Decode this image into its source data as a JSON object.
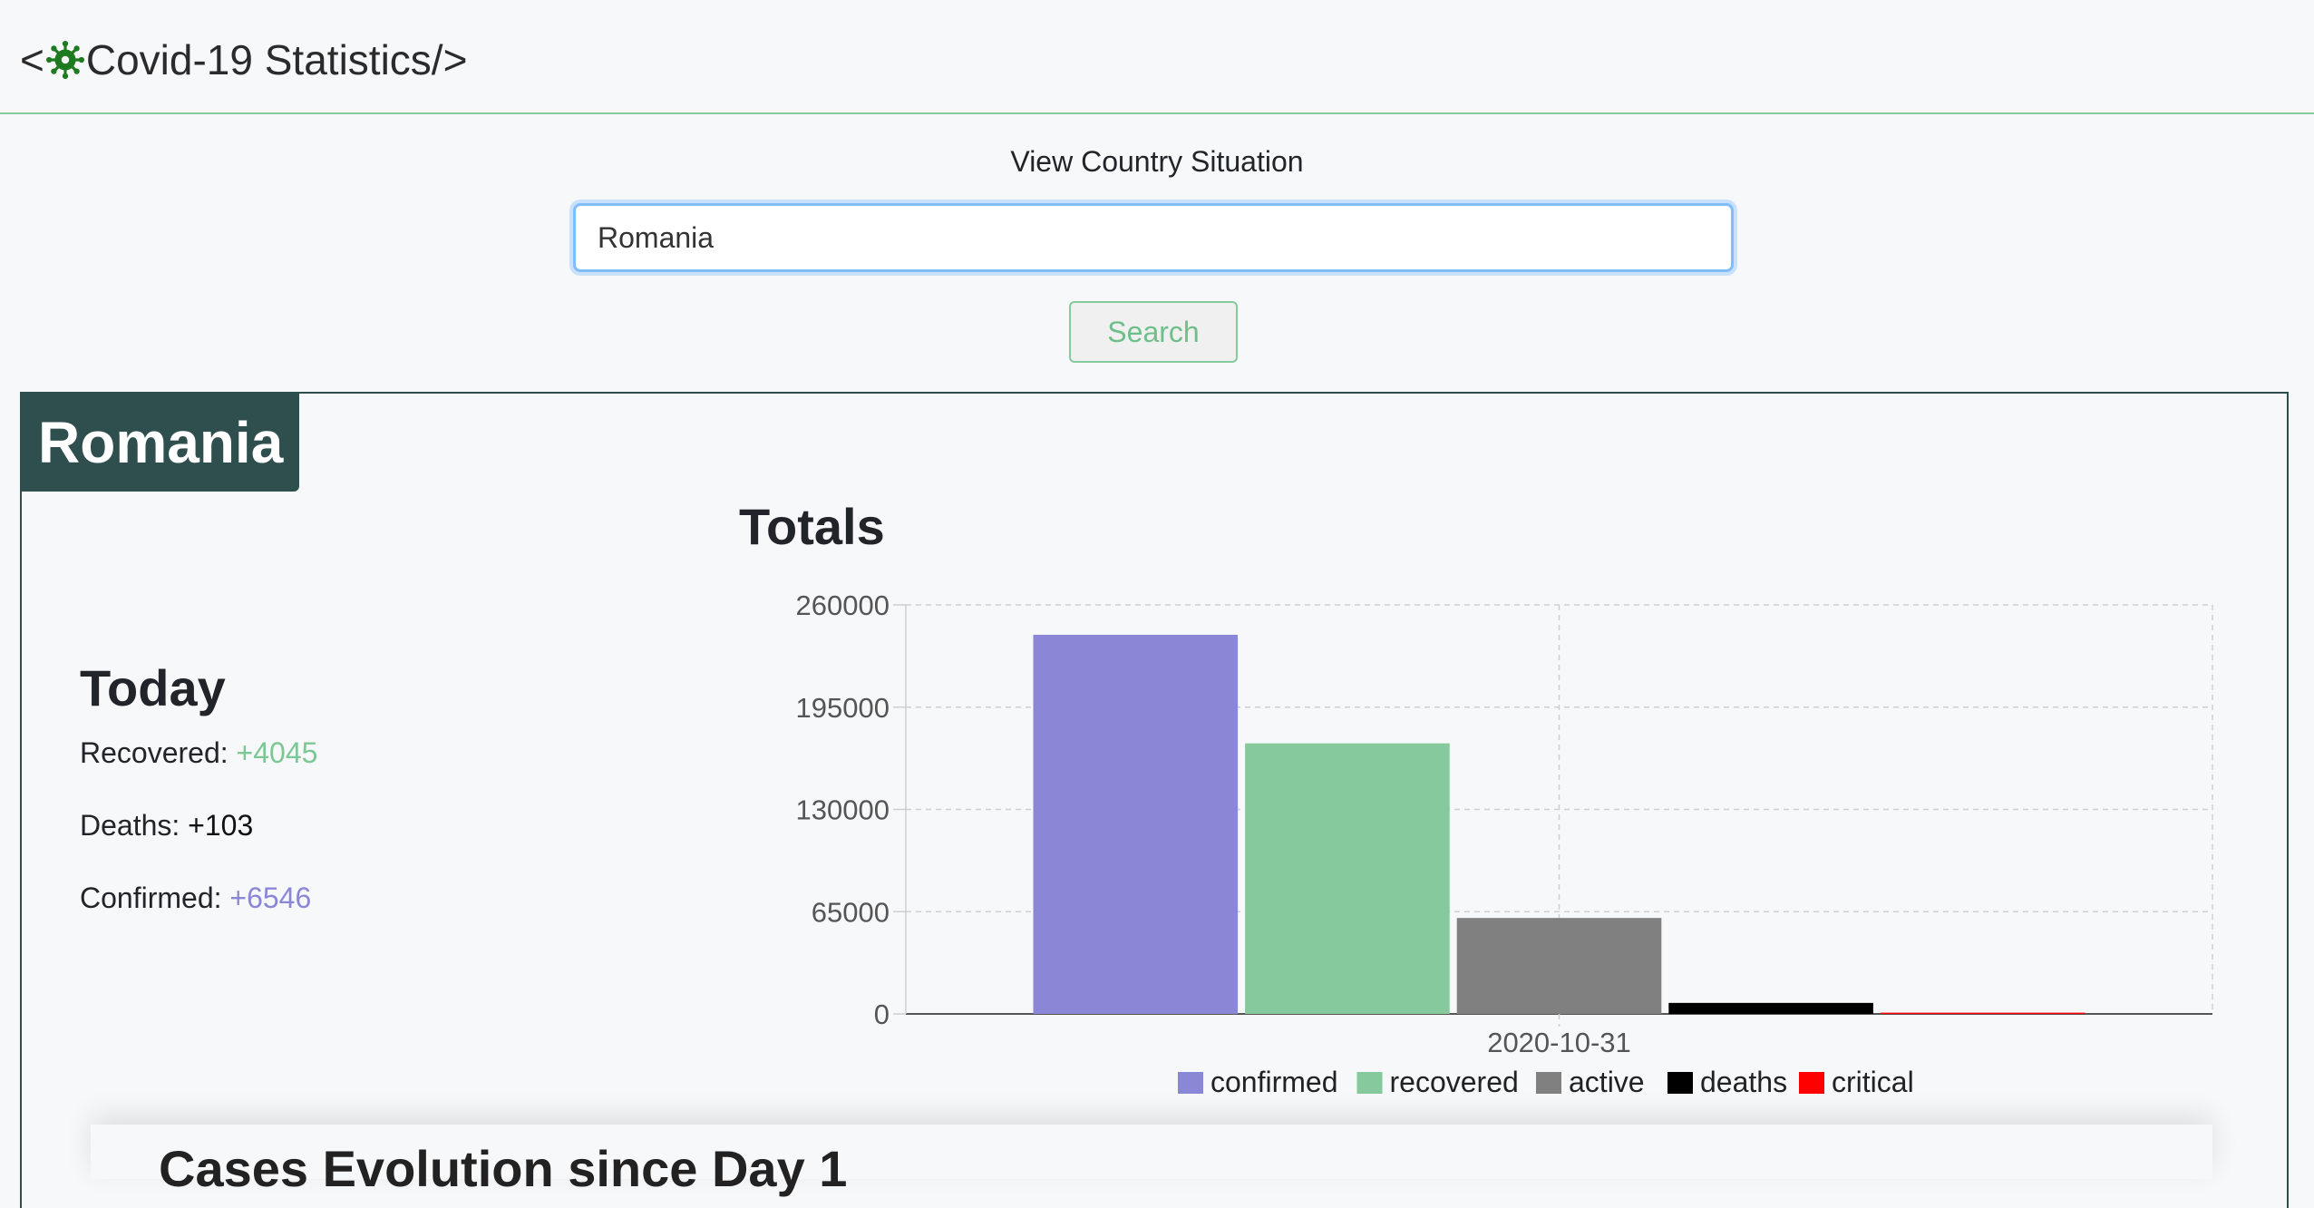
{
  "brand": {
    "prefix": "<",
    "title": "Covid-19 Statistics/>"
  },
  "search": {
    "label": "View Country Situation",
    "value": "Romania",
    "button": "Search"
  },
  "country": "Romania",
  "today": {
    "title": "Today",
    "rows": [
      {
        "label": "Recovered: ",
        "value": "+4045",
        "color": "#7cc894"
      },
      {
        "label": "Deaths: ",
        "value": "+103",
        "color": "#111111"
      },
      {
        "label": "Confirmed: ",
        "value": "+6546",
        "color": "#8a87d6"
      }
    ]
  },
  "totals": {
    "title": "Totals"
  },
  "next_section": {
    "title": "Cases Evolution since Day 1"
  },
  "chart_data": {
    "type": "bar",
    "categories": [
      "2020-10-31"
    ],
    "series": [
      {
        "name": "confirmed",
        "values": [
          241000
        ],
        "color": "#8a87d6"
      },
      {
        "name": "recovered",
        "values": [
          172000
        ],
        "color": "#86c99c"
      },
      {
        "name": "active",
        "values": [
          61000
        ],
        "color": "#808080"
      },
      {
        "name": "deaths",
        "values": [
          7000
        ],
        "color": "#000000"
      },
      {
        "name": "critical",
        "values": [
          800
        ],
        "color": "#ff0000"
      }
    ],
    "yticks": [
      0,
      65000,
      130000,
      195000,
      260000
    ],
    "ylim": [
      0,
      260000
    ],
    "grid": true,
    "legend": "bottom"
  }
}
